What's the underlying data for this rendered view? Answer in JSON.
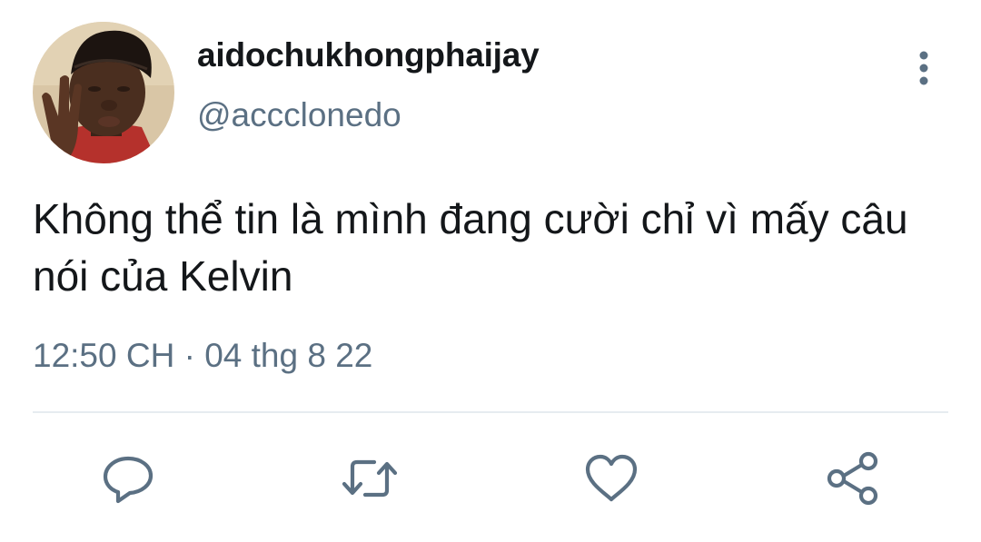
{
  "tweet": {
    "display_name": "aidochukhongphaijay",
    "handle": "@accclonedo",
    "text": "Không thể tin là mình đang cười chỉ vì mấy câu nói của Kelvin",
    "timestamp": "12:50 CH · 04 thg 8 22"
  },
  "icons": {
    "more": "more-vertical-icon",
    "reply": "reply-icon",
    "retweet": "retweet-icon",
    "like": "heart-icon",
    "share": "share-icon"
  },
  "colors": {
    "text": "#14171a",
    "secondary": "#5b7083",
    "divider": "#e6ecf0"
  }
}
